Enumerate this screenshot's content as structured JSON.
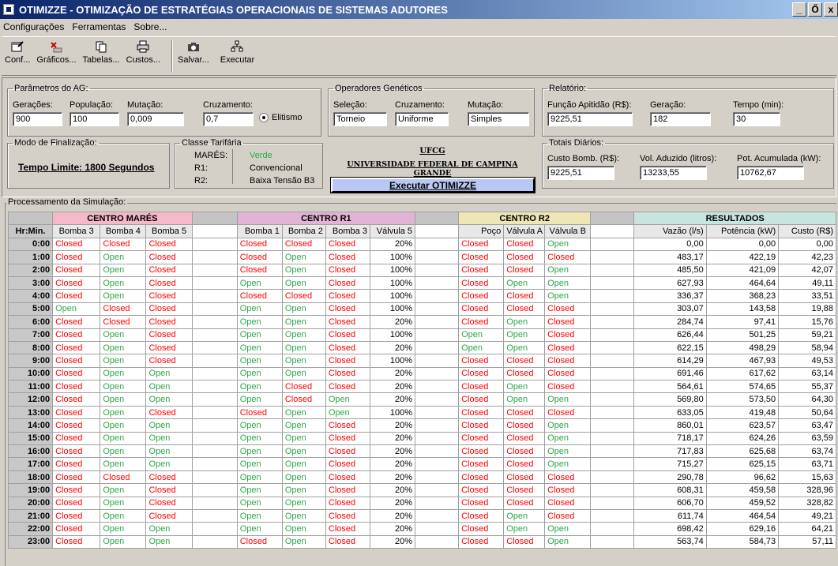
{
  "window": {
    "title": "OTIMIZZE - OTIMIZAÇÃO DE ESTRATÉGIAS OPERACIONAIS DE SISTEMAS ADUTORES",
    "min": "_",
    "max": "Ő",
    "close": "x"
  },
  "menu": [
    "Configurações",
    "Ferramentas",
    "Sobre..."
  ],
  "toolbar": {
    "conf": "Conf...",
    "graficos": "Gráficos...",
    "tabelas": "Tabelas...",
    "custos": "Custos...",
    "salvar": "Salvar...",
    "executar": "Executar"
  },
  "ag": {
    "legend": "Parâmetros do AG:",
    "geracoes_label": "Gerações:",
    "geracoes": "900",
    "populacao_label": "População:",
    "populacao": "100",
    "mutacao_label": "Mutação:",
    "mutacao": "0,009",
    "cruzamento_label": "Cruzamento:",
    "cruzamento": "0,7",
    "elitismo": "Elitismo"
  },
  "operadores": {
    "legend": "Operadores Genéticos",
    "selecao_label": "Seleção:",
    "selecao": "Torneio",
    "cruzamento_label": "Cruzamento:",
    "cruzamento": "Uniforme",
    "mutacao_label": "Mutação:",
    "mutacao": "Simples"
  },
  "relatorio": {
    "legend": "Relatório:",
    "funcao_label": "Função Apitidão (R$):",
    "funcao": "9225,51",
    "geracao_label": "Geração:",
    "geracao": "182",
    "tempo_label": "Tempo (min):",
    "tempo": "30"
  },
  "finalizacao": {
    "legend": "Modo de Finalização:",
    "value": "Tempo Limite: 1800 Segundos"
  },
  "tarifaria": {
    "legend": "Classe Tarifária",
    "k1": "MARÉS:",
    "v1": "Verde",
    "k2": "R1:",
    "v2": "Convencional",
    "k3": "R2:",
    "v3": "Baixa Tensão B3"
  },
  "ufcg": {
    "short": "UFCG",
    "long": "UNIVERSIDADE FEDERAL DE CAMPINA GRANDE",
    "button": "Executar OTIMIZZE"
  },
  "totais": {
    "legend": "Totais Diários:",
    "custo_label": "Custo Bomb. (R$):",
    "custo": "9225,51",
    "vol_label": "Vol. Aduzido (litros):",
    "vol": "13233,55",
    "pot_label": "Pot. Acumulada (kW):",
    "pot": "10762,67"
  },
  "processamento": {
    "legend": "Processamento da Simulação:"
  },
  "grid": {
    "groups": [
      "CENTRO MARÉS",
      "CENTRO R1",
      "CENTRO R2",
      "RESULTADOS"
    ],
    "columns": [
      "Hr:Min.",
      "Bomba 3",
      "Bomba 4",
      "Bomba 5",
      "Bomba 1",
      "Bomba 2",
      "Bomba 3",
      "Válvula 5",
      "Poço",
      "Válvula A",
      "Válvula B",
      "Vazão (l/s)",
      "Potência (kW)",
      "Custo (R$)"
    ],
    "rows": [
      [
        "0:00",
        "Closed",
        "Closed",
        "Closed",
        "Closed",
        "Closed",
        "Closed",
        "20%",
        "Closed",
        "Closed",
        "Open",
        "0,00",
        "0,00",
        "0,00"
      ],
      [
        "1:00",
        "Closed",
        "Open",
        "Closed",
        "Closed",
        "Open",
        "Closed",
        "100%",
        "Closed",
        "Closed",
        "Closed",
        "483,17",
        "422,19",
        "42,23"
      ],
      [
        "2:00",
        "Closed",
        "Open",
        "Closed",
        "Closed",
        "Open",
        "Closed",
        "100%",
        "Closed",
        "Closed",
        "Open",
        "485,50",
        "421,09",
        "42,07"
      ],
      [
        "3:00",
        "Closed",
        "Open",
        "Closed",
        "Open",
        "Open",
        "Closed",
        "100%",
        "Closed",
        "Open",
        "Open",
        "627,93",
        "464,64",
        "49,11"
      ],
      [
        "4:00",
        "Closed",
        "Open",
        "Closed",
        "Closed",
        "Closed",
        "Closed",
        "100%",
        "Closed",
        "Closed",
        "Open",
        "336,37",
        "368,23",
        "33,51"
      ],
      [
        "5:00",
        "Open",
        "Closed",
        "Closed",
        "Open",
        "Open",
        "Closed",
        "100%",
        "Closed",
        "Closed",
        "Closed",
        "303,07",
        "143,58",
        "19,88"
      ],
      [
        "6:00",
        "Closed",
        "Closed",
        "Closed",
        "Open",
        "Open",
        "Closed",
        "20%",
        "Closed",
        "Open",
        "Closed",
        "284,74",
        "97,41",
        "15,76"
      ],
      [
        "7:00",
        "Closed",
        "Open",
        "Closed",
        "Open",
        "Open",
        "Closed",
        "100%",
        "Open",
        "Open",
        "Closed",
        "626,44",
        "501,25",
        "59,21"
      ],
      [
        "8:00",
        "Closed",
        "Open",
        "Closed",
        "Open",
        "Open",
        "Closed",
        "20%",
        "Open",
        "Open",
        "Closed",
        "622,15",
        "498,29",
        "58,94"
      ],
      [
        "9:00",
        "Closed",
        "Open",
        "Closed",
        "Open",
        "Open",
        "Closed",
        "100%",
        "Closed",
        "Closed",
        "Closed",
        "614,29",
        "467,93",
        "49,53"
      ],
      [
        "10:00",
        "Closed",
        "Open",
        "Open",
        "Open",
        "Open",
        "Closed",
        "20%",
        "Closed",
        "Closed",
        "Closed",
        "691,46",
        "617,62",
        "63,14"
      ],
      [
        "11:00",
        "Closed",
        "Open",
        "Open",
        "Open",
        "Closed",
        "Closed",
        "20%",
        "Closed",
        "Open",
        "Closed",
        "564,61",
        "574,65",
        "55,37"
      ],
      [
        "12:00",
        "Closed",
        "Open",
        "Open",
        "Open",
        "Closed",
        "Open",
        "20%",
        "Closed",
        "Open",
        "Open",
        "569,80",
        "573,50",
        "64,30"
      ],
      [
        "13:00",
        "Closed",
        "Open",
        "Closed",
        "Closed",
        "Open",
        "Open",
        "100%",
        "Closed",
        "Closed",
        "Closed",
        "633,05",
        "419,48",
        "50,64"
      ],
      [
        "14:00",
        "Closed",
        "Open",
        "Open",
        "Open",
        "Open",
        "Closed",
        "20%",
        "Closed",
        "Closed",
        "Open",
        "860,01",
        "623,57",
        "63,47"
      ],
      [
        "15:00",
        "Closed",
        "Open",
        "Open",
        "Open",
        "Open",
        "Closed",
        "20%",
        "Closed",
        "Closed",
        "Open",
        "718,17",
        "624,26",
        "63,59"
      ],
      [
        "16:00",
        "Closed",
        "Open",
        "Open",
        "Open",
        "Open",
        "Closed",
        "20%",
        "Closed",
        "Closed",
        "Open",
        "717,83",
        "625,68",
        "63,74"
      ],
      [
        "17:00",
        "Closed",
        "Open",
        "Open",
        "Open",
        "Open",
        "Closed",
        "20%",
        "Closed",
        "Closed",
        "Open",
        "715,27",
        "625,15",
        "63,71"
      ],
      [
        "18:00",
        "Closed",
        "Closed",
        "Closed",
        "Open",
        "Open",
        "Closed",
        "20%",
        "Closed",
        "Closed",
        "Closed",
        "290,78",
        "96,62",
        "15,63"
      ],
      [
        "19:00",
        "Closed",
        "Open",
        "Closed",
        "Open",
        "Open",
        "Closed",
        "20%",
        "Closed",
        "Closed",
        "Closed",
        "608,31",
        "459,58",
        "328,96"
      ],
      [
        "20:00",
        "Closed",
        "Open",
        "Closed",
        "Open",
        "Open",
        "Closed",
        "20%",
        "Closed",
        "Closed",
        "Closed",
        "606,70",
        "459,52",
        "328,82"
      ],
      [
        "21:00",
        "Closed",
        "Open",
        "Closed",
        "Open",
        "Open",
        "Closed",
        "20%",
        "Closed",
        "Open",
        "Closed",
        "611,74",
        "464,54",
        "49,21"
      ],
      [
        "22:00",
        "Closed",
        "Open",
        "Open",
        "Open",
        "Open",
        "Closed",
        "20%",
        "Closed",
        "Open",
        "Open",
        "698,42",
        "629,16",
        "64,21"
      ],
      [
        "23:00",
        "Closed",
        "Open",
        "Open",
        "Closed",
        "Open",
        "Closed",
        "20%",
        "Closed",
        "Closed",
        "Open",
        "563,74",
        "584,73",
        "57,11"
      ]
    ]
  },
  "colors": {
    "title": "#0a246a",
    "closed": "#ff0000",
    "open": "#2ea84a",
    "mares": "#f4b8c8",
    "r1": "#e1b4d6",
    "r2": "#efe6b6",
    "resultados": "#c8e4de"
  }
}
